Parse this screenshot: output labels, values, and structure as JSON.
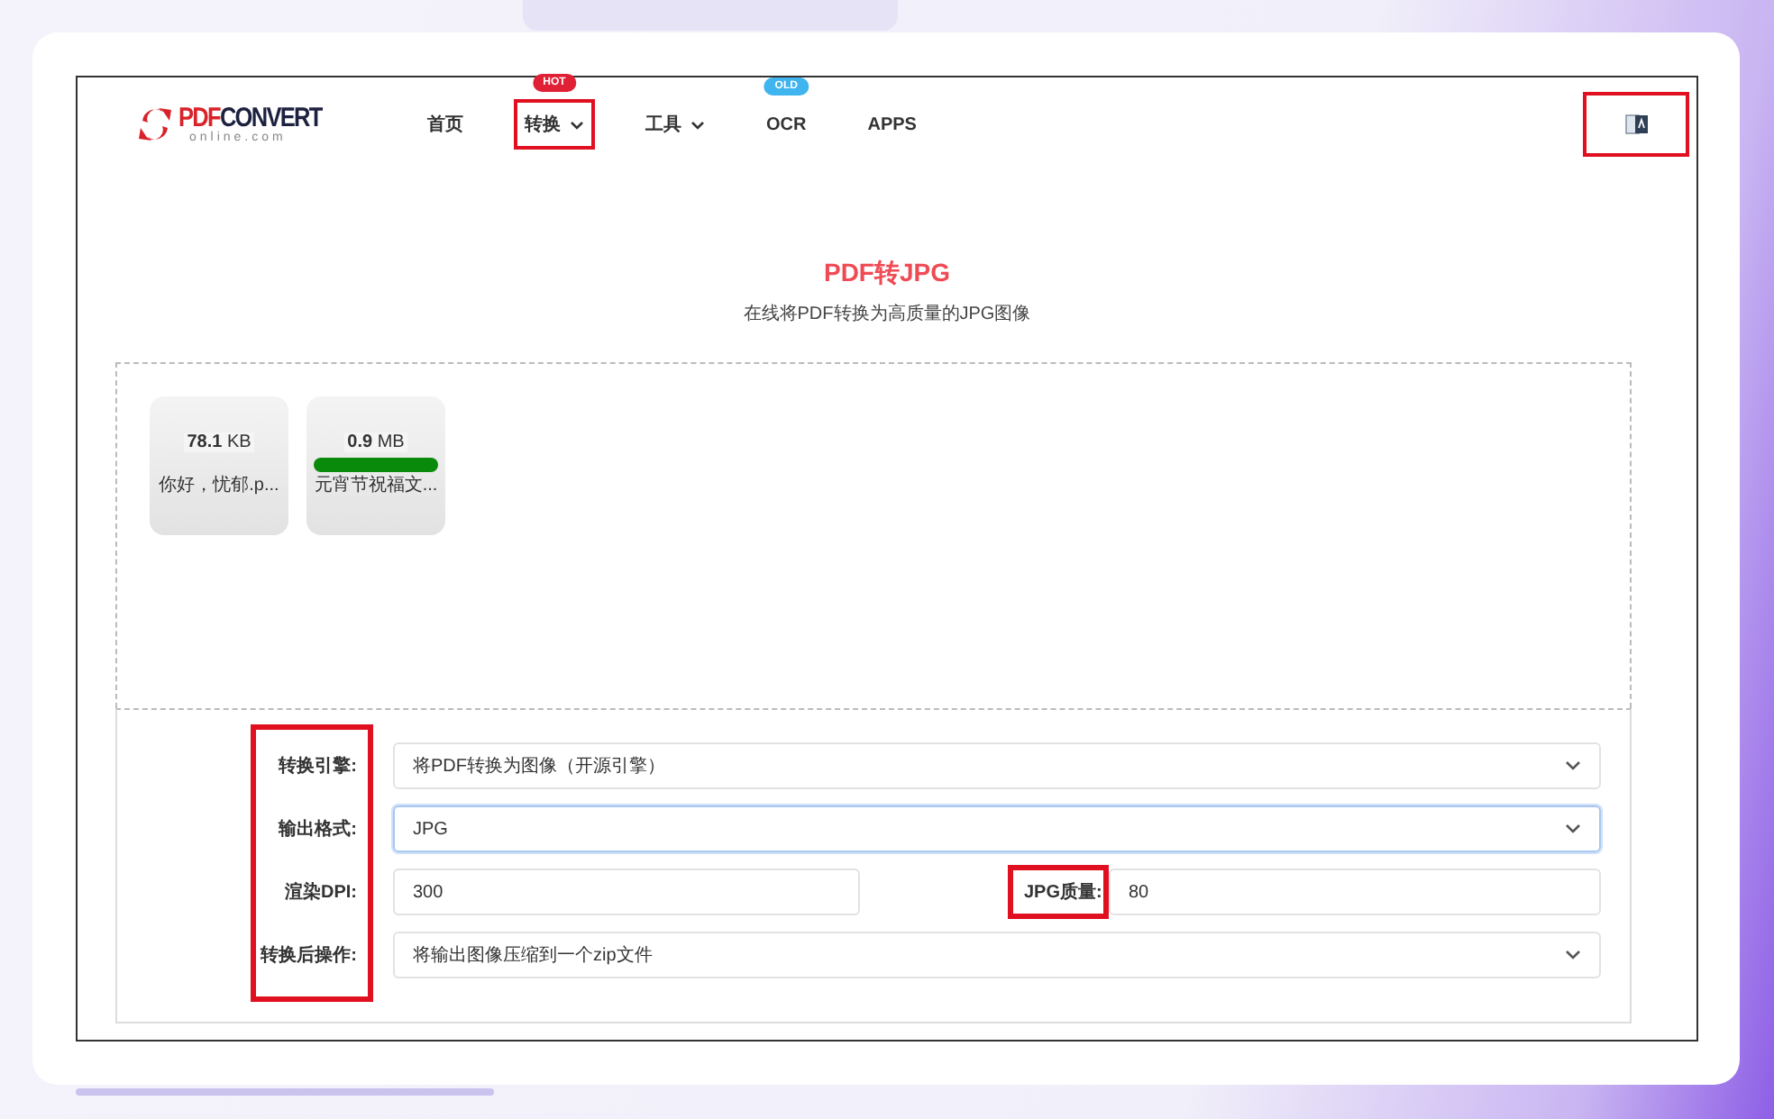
{
  "logo": {
    "primary": "PDF",
    "secondary": "CONVERT",
    "tagline": "online.com"
  },
  "nav": [
    {
      "label": "首页",
      "dropdown": false,
      "highlighted": false
    },
    {
      "label": "转换",
      "dropdown": true,
      "highlighted": true,
      "badge": {
        "text": "HOT",
        "color": "#e02035"
      }
    },
    {
      "label": "工具",
      "dropdown": true,
      "highlighted": false
    },
    {
      "label": "OCR",
      "dropdown": false,
      "highlighted": false,
      "badge": {
        "text": "OLD",
        "color": "#3fb4ef"
      }
    },
    {
      "label": "APPS",
      "dropdown": false,
      "highlighted": false
    }
  ],
  "language_button": {
    "highlighted": true
  },
  "title": "PDF转JPG",
  "subtitle": "在线将PDF转换为高质量的JPG图像",
  "files": [
    {
      "size_value": "78.1",
      "size_unit": "KB",
      "name": "你好，忧郁.p..."
    },
    {
      "size_value": "0.9",
      "size_unit": "MB",
      "name": "元宵节祝福文...",
      "level": 1
    }
  ],
  "options": {
    "labels_highlighted": true,
    "rows": [
      {
        "fields": [
          {
            "label": "转换引擎:",
            "kind": "select",
            "value": "将PDF转换为图像（开源引擎）",
            "focused": false
          }
        ]
      },
      {
        "fields": [
          {
            "label": "输出格式:",
            "kind": "select",
            "value": "JPG",
            "focused": true
          }
        ]
      },
      {
        "fields": [
          {
            "label": "渲染DPI:",
            "kind": "input",
            "value": "300",
            "focused": false
          },
          {
            "label": "JPG质量:",
            "kind": "input",
            "value": "80",
            "focused": false,
            "highlighted": true
          }
        ]
      },
      {
        "fields": [
          {
            "label": "转换后操作:",
            "kind": "select",
            "value": "将输出图像压缩到一个zip文件",
            "focused": false
          }
        ]
      }
    ]
  }
}
